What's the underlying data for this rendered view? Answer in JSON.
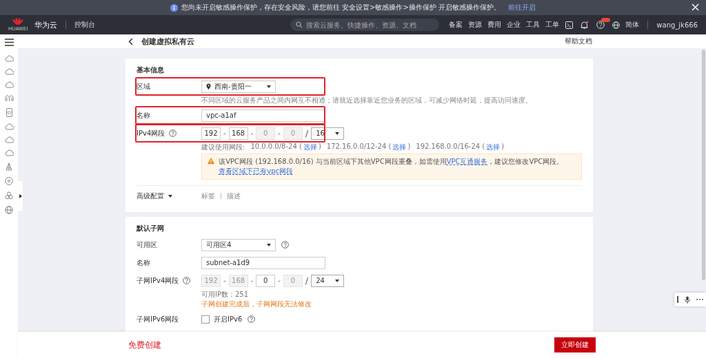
{
  "banner": {
    "text": "您尚未开启敏感操作保护，存在安全风险，请您前往 安全设置>敏感操作>操作保护 开启敏感操作保护。",
    "link": "前往开启"
  },
  "header": {
    "logo_text": "HUAWEI",
    "brand": "华为云",
    "console": "控制台",
    "search_placeholder": "搜索云服务、快捷操作、资源、文档",
    "nav": [
      "备案",
      "资源",
      "费用",
      "企业",
      "工具",
      "工单"
    ],
    "language": "简体",
    "user": "wang_jk666"
  },
  "page": {
    "title": "创建虚拟私有云",
    "help": "帮助文档"
  },
  "basic": {
    "heading": "基本信息",
    "rows": [
      {
        "kind": "select",
        "label": "区域",
        "value": "西南-贵阳一",
        "pin": true,
        "help": false,
        "highlighted": true,
        "hint": "不同区域的云服务产品之间内网互不相通；请就近选择靠近您业务的区域，可减少网络时延，提高访问速度。"
      },
      {
        "kind": "input",
        "label": "名称",
        "value": "vpc-a1af",
        "help": false,
        "highlighted": true
      },
      {
        "kind": "ip",
        "label": "IPv4网段",
        "help": true,
        "highlighted": true,
        "octets": [
          {
            "value": "192",
            "disabled": false
          },
          {
            "value": "168",
            "disabled": false
          },
          {
            "value": "0",
            "disabled": true
          },
          {
            "value": "0",
            "disabled": true
          }
        ],
        "mask": "16",
        "separator": "-",
        "slash": "/"
      }
    ],
    "suggest_label": "建议使用网段:",
    "suggestions": [
      {
        "prefix": "10.0.0.0/8-24 (",
        "link": "选择",
        "suffix": ")"
      },
      {
        "prefix": "172.16.0.0/12-24 (",
        "link": "选择",
        "suffix": ")"
      },
      {
        "prefix": "192.168.0.0/16-24 (",
        "link": "选择",
        "suffix": ")"
      }
    ],
    "warning": [
      {
        "kind": "text",
        "text": "该VPC网段 (192.168.0.0/16) 与当前区域下其他VPC网段重叠，如需使用"
      },
      {
        "kind": "link",
        "text": "VPC互通服务"
      },
      {
        "kind": "text",
        "text": "，建议您修改VPC网段。"
      },
      {
        "kind": "link",
        "text": "查看区域下已有vpc网段"
      }
    ],
    "advanced": {
      "label": "高级配置",
      "links": [
        "标签",
        "描述"
      ]
    }
  },
  "subnet": {
    "heading": "默认子网",
    "rows": [
      {
        "kind": "select",
        "label": "可用区",
        "value": "可用区4",
        "pin": false,
        "help": true,
        "highlighted": false
      },
      {
        "kind": "input",
        "label": "名称",
        "value": "subnet-a1d9",
        "help": false,
        "highlighted": false
      },
      {
        "kind": "ip",
        "label": "子网IPv4网段",
        "help": true,
        "highlighted": false,
        "octets": [
          {
            "value": "192",
            "disabled": true
          },
          {
            "value": "168",
            "disabled": true
          },
          {
            "value": "0",
            "disabled": false
          },
          {
            "value": "0",
            "disabled": true
          }
        ],
        "mask": "24",
        "separator": "-",
        "slash": "/",
        "count": "可用IP数：251",
        "note": "子网创建完成后，子网网段无法修改"
      },
      {
        "kind": "check",
        "label": "子网IPv6网段",
        "text": "开启IPv6",
        "checked": false,
        "help": true,
        "highlighted": false
      }
    ]
  },
  "footer": {
    "promo": "免费创建",
    "button": "立即创建"
  }
}
